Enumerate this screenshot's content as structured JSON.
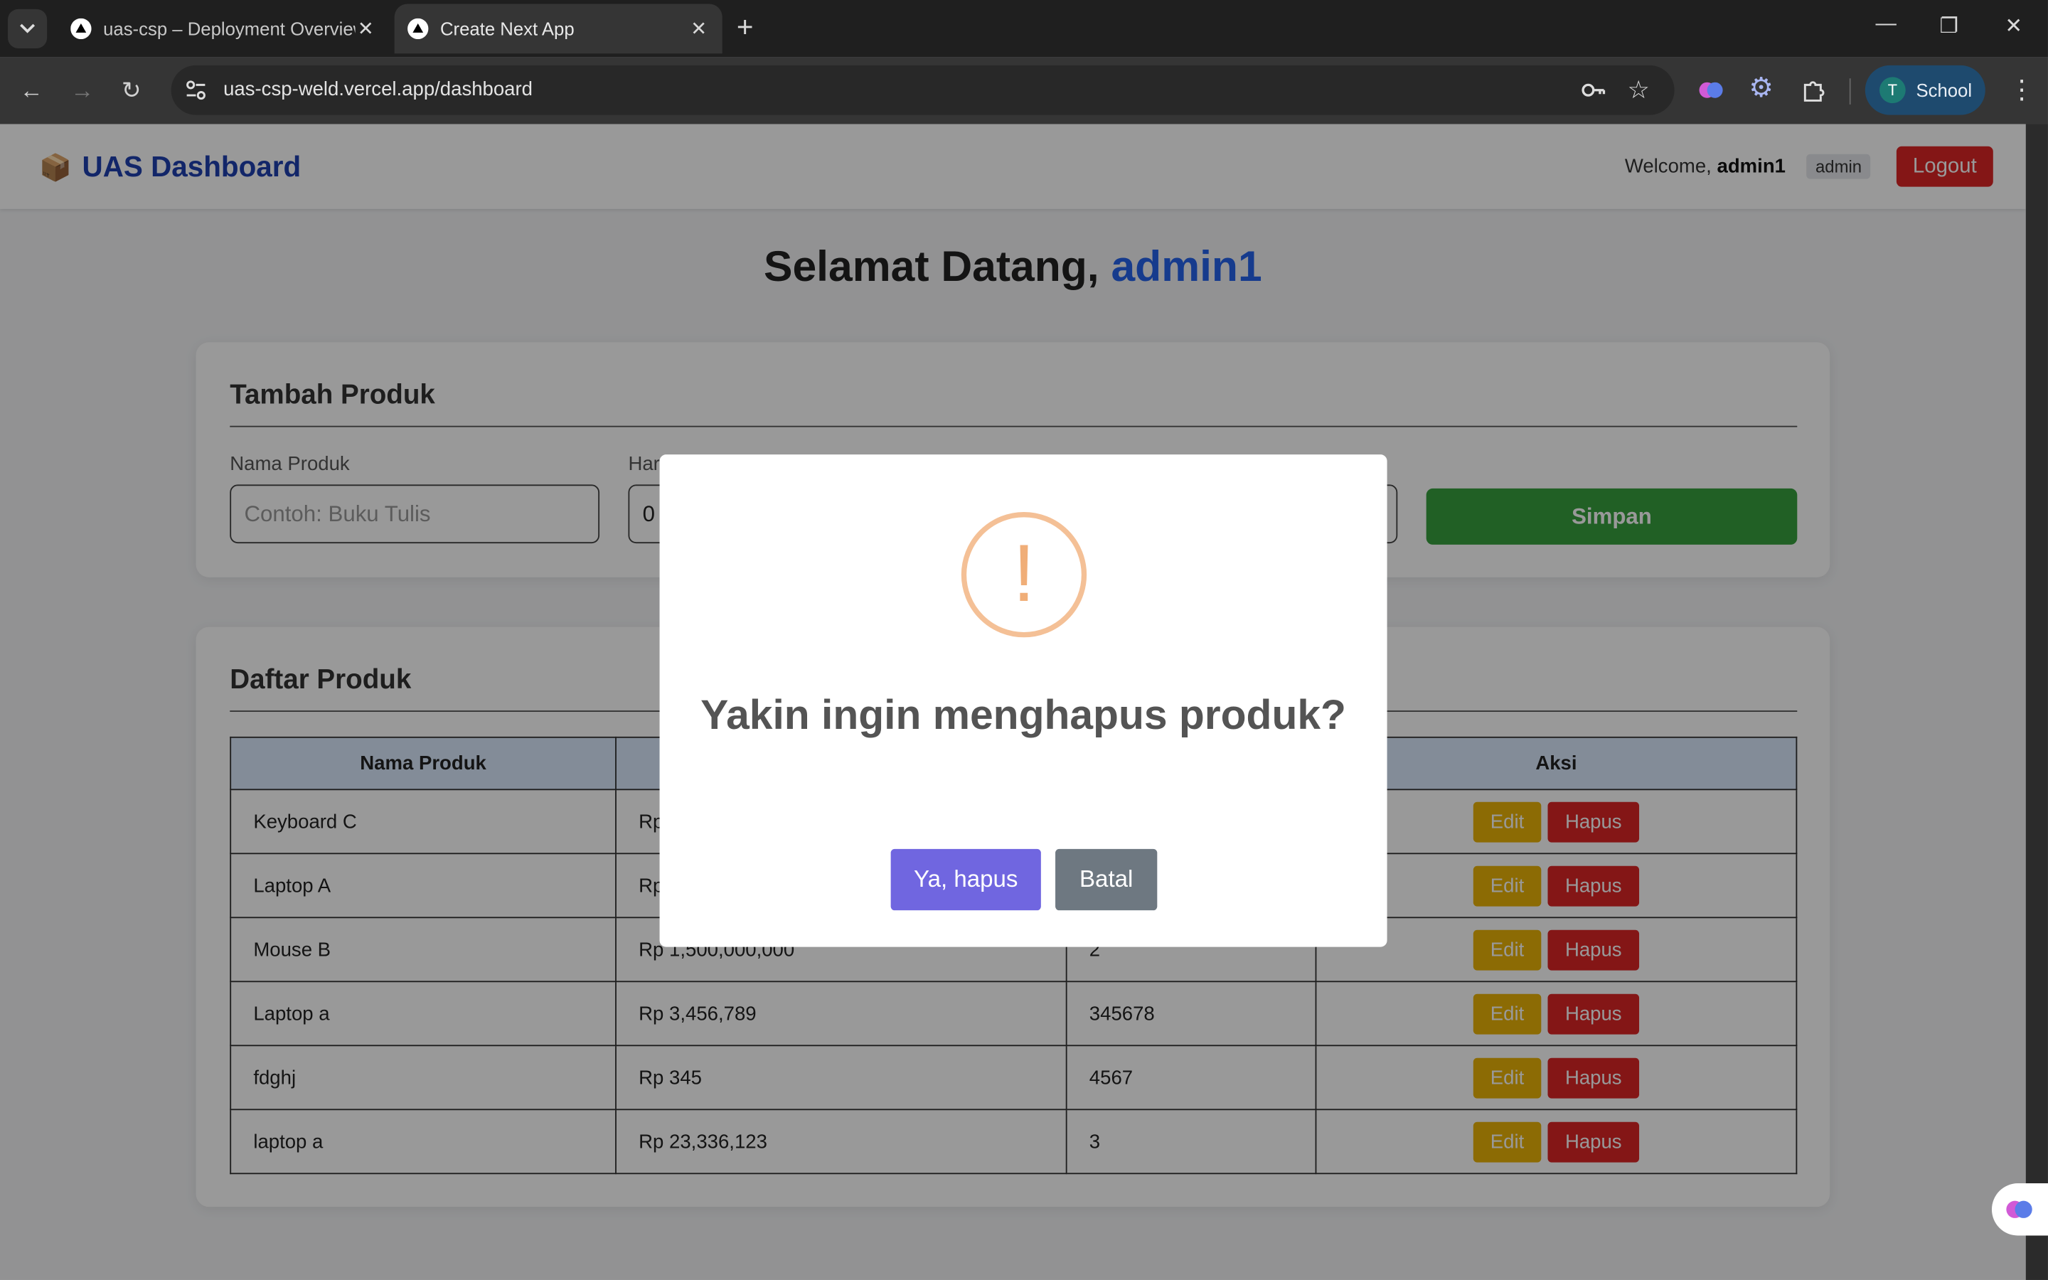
{
  "browser": {
    "tabs": [
      {
        "title": "uas-csp – Deployment Overview",
        "active": false
      },
      {
        "title": "Create Next App",
        "active": true
      }
    ],
    "url": "uas-csp-weld.vercel.app/dashboard",
    "profile": {
      "initial": "T",
      "label": "School"
    }
  },
  "header": {
    "brand": "UAS Dashboard",
    "welcome_prefix": "Welcome,",
    "username": "admin1",
    "role": "admin",
    "logout": "Logout"
  },
  "greeting": {
    "prefix": "Selamat Datang,",
    "user": "admin1"
  },
  "add_form": {
    "title": "Tambah Produk",
    "name_label": "Nama Produk",
    "name_placeholder": "Contoh: Buku Tulis",
    "price_label": "Har",
    "price_value": "0",
    "save": "Simpan"
  },
  "product_list": {
    "title": "Daftar Produk",
    "columns": [
      "Nama Produk",
      "",
      "",
      "Aksi"
    ],
    "rows": [
      {
        "name": "Keyboard C",
        "price": "Rp",
        "stock": ""
      },
      {
        "name": "Laptop A",
        "price": "Rp",
        "stock": ""
      },
      {
        "name": "Mouse B",
        "price": "Rp 1,500,000,000",
        "stock": "2"
      },
      {
        "name": "Laptop a",
        "price": "Rp 3,456,789",
        "stock": "345678"
      },
      {
        "name": "fdghj",
        "price": "Rp 345",
        "stock": "4567"
      },
      {
        "name": "laptop a",
        "price": "Rp 23,336,123",
        "stock": "3"
      }
    ],
    "edit_label": "Edit",
    "delete_label": "Hapus"
  },
  "modal": {
    "icon": "!",
    "title": "Yakin ingin menghapus produk?",
    "confirm": "Ya, hapus",
    "cancel": "Batal"
  },
  "colors": {
    "brand": "#1e40af",
    "danger": "#dc2626",
    "warning": "#eab308",
    "success": "#38a13e",
    "confirm": "#7066e0",
    "cancel": "#6e7881"
  }
}
